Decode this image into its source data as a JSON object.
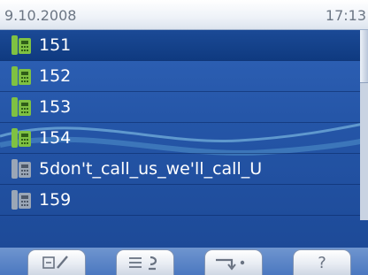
{
  "status": {
    "date": "9.10.2008",
    "time": "17:13"
  },
  "entries": [
    {
      "label": "151",
      "icon": "phone-green-icon",
      "selected": true
    },
    {
      "label": "152",
      "icon": "phone-green-icon",
      "selected": false
    },
    {
      "label": "153",
      "icon": "phone-green-icon",
      "selected": false
    },
    {
      "label": "154",
      "icon": "phone-green-icon",
      "selected": false
    },
    {
      "label": "5don't_call_us_we'll_call_U",
      "icon": "phone-gray-icon",
      "selected": false
    },
    {
      "label": "159",
      "icon": "phone-gray-icon",
      "selected": false
    }
  ],
  "softkeys": [
    {
      "name": "edit-icon"
    },
    {
      "name": "list-return-icon"
    },
    {
      "name": "forward-icon"
    },
    {
      "label": "?",
      "name": "help-icon"
    }
  ],
  "colors": {
    "list_background": "#2556a8",
    "selected_row": "#0f3a80",
    "available_icon": "#7fc142",
    "unavailable_icon": "#9aa6b6"
  }
}
